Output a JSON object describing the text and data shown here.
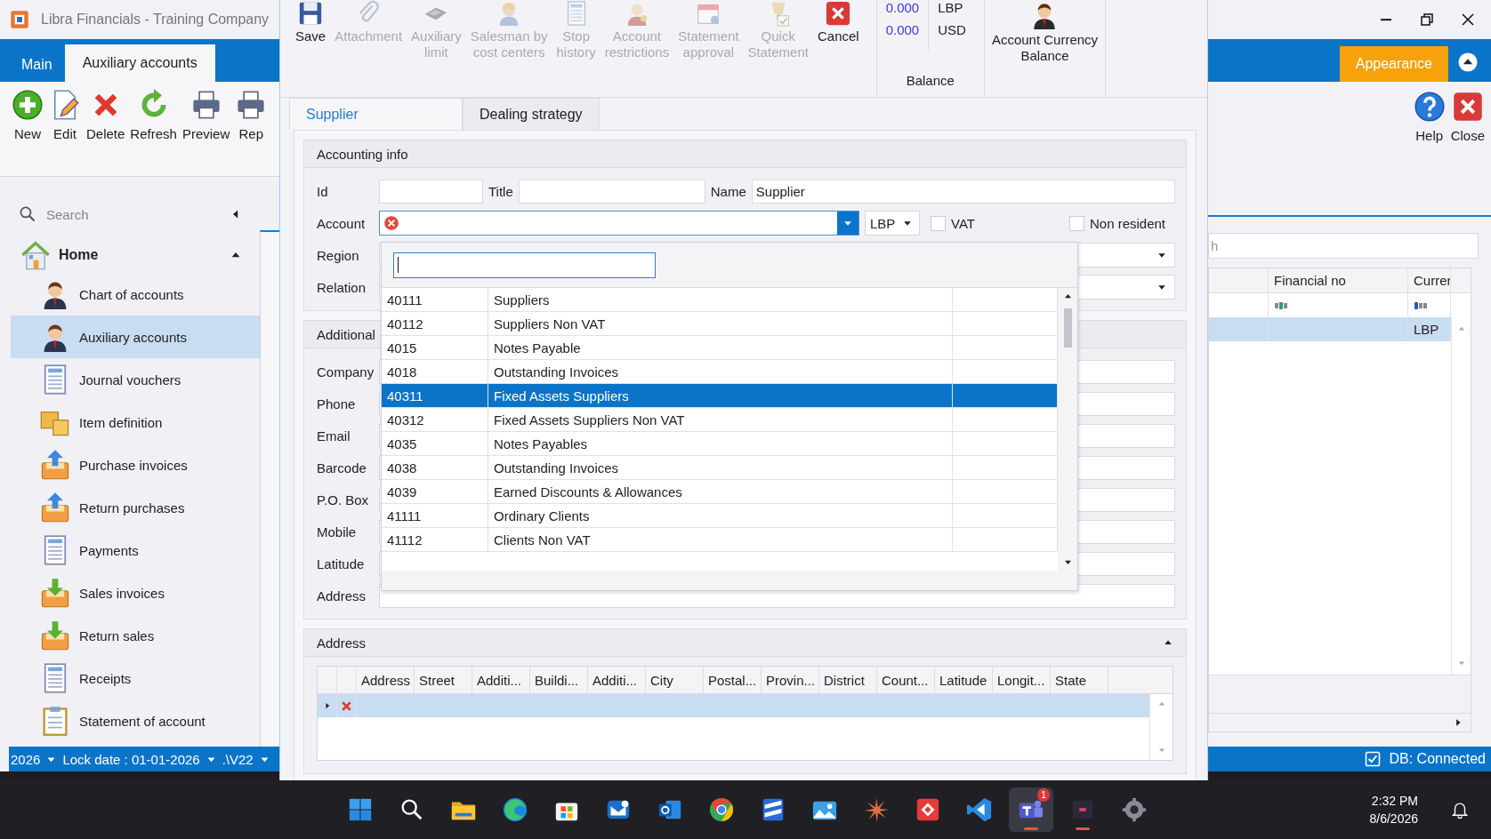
{
  "main_window": {
    "title": "Libra Financials - Training Company",
    "ribbon_tabs": [
      {
        "label": "Main",
        "selected": false
      },
      {
        "label": "Auxiliary accounts",
        "selected": true
      }
    ],
    "ribbon_buttons": [
      {
        "label": "New",
        "kind": "new"
      },
      {
        "label": "Edit",
        "kind": "edit"
      },
      {
        "label": "Delete",
        "kind": "delete"
      },
      {
        "label": "Refresh",
        "kind": "refresh"
      },
      {
        "label": "Preview",
        "kind": "printer"
      },
      {
        "label": "Rep",
        "kind": "printer"
      }
    ],
    "sidebar": {
      "search_placeholder": "Search",
      "group": {
        "label": "Home",
        "expanded": true
      },
      "items": [
        {
          "label": "Chart of accounts",
          "kind": "person",
          "selected": false
        },
        {
          "label": "Auxiliary accounts",
          "kind": "person",
          "selected": true
        },
        {
          "label": "Journal vouchers",
          "kind": "doc",
          "selected": false
        },
        {
          "label": "Item definition",
          "kind": "boxes",
          "selected": false
        },
        {
          "label": "Purchase invoices",
          "kind": "tray-up",
          "selected": false
        },
        {
          "label": "Return purchases",
          "kind": "tray-up",
          "selected": false
        },
        {
          "label": "Payments",
          "kind": "doc",
          "selected": false
        },
        {
          "label": "Sales invoices",
          "kind": "tray-down",
          "selected": false
        },
        {
          "label": "Return sales",
          "kind": "tray-down",
          "selected": false
        },
        {
          "label": "Receipts",
          "kind": "doc",
          "selected": false
        },
        {
          "label": "Statement of account",
          "kind": "clipboard",
          "selected": false
        }
      ]
    },
    "status_bar": {
      "year": "2026",
      "lock_date": "Lock date : 01-01-2026",
      "database": ".\\V22"
    },
    "appearance_button": "Appearance",
    "right_buttons": [
      {
        "label": "Help",
        "kind": "help"
      },
      {
        "label": "Close",
        "kind": "close"
      }
    ],
    "grid": {
      "search_value": "h",
      "columns": [
        {
          "label": "Financial no",
          "kind": "contains"
        },
        {
          "label": "Currer",
          "kind": "begins"
        }
      ],
      "rows": [
        {
          "currency": "LBP",
          "selected": true
        }
      ]
    },
    "db_status": {
      "label": "DB: Connected",
      "checked": true
    }
  },
  "dialog": {
    "toolbar": [
      {
        "lines": [
          "Save"
        ],
        "kind": "save",
        "disabled": false
      },
      {
        "lines": [
          "Attachment"
        ],
        "kind": "clip",
        "disabled": true
      },
      {
        "lines": [
          "Auxiliary",
          "limit"
        ],
        "kind": "card",
        "disabled": true
      },
      {
        "lines": [
          "Salesman by",
          "cost centers"
        ],
        "kind": "worker",
        "disabled": true
      },
      {
        "lines": [
          "Stop",
          "history"
        ],
        "kind": "page",
        "disabled": true
      },
      {
        "lines": [
          "Account",
          "restrictions"
        ],
        "kind": "keyperson",
        "disabled": true
      },
      {
        "lines": [
          "Statement",
          "approval"
        ],
        "kind": "calendar",
        "disabled": true
      },
      {
        "lines": [
          "Quick",
          "Statement"
        ],
        "kind": "quick",
        "disabled": true
      },
      {
        "lines": [
          "Cancel"
        ],
        "kind": "cancel",
        "disabled": false
      }
    ],
    "balance": {
      "rows": [
        {
          "amount": "0.000",
          "currency": "LBP"
        },
        {
          "amount": "0.000",
          "currency": "USD"
        }
      ],
      "label": "Balance"
    },
    "currency_balance_button": [
      "Account Currency",
      "Balance"
    ],
    "tabs": [
      {
        "label": "Supplier",
        "selected": true
      },
      {
        "label": "Dealing strategy",
        "selected": false
      }
    ],
    "accounting_info": {
      "title": "Accounting info",
      "id_label": "Id",
      "title_label": "Title",
      "name_label": "Name",
      "name_value": "Supplier",
      "account_label": "Account",
      "account_error": true,
      "currency": "LBP",
      "vat": {
        "label": "VAT",
        "checked": false
      },
      "non_resident": {
        "label": "Non resident",
        "checked": false
      },
      "region_label": "Region",
      "relation_label": "Relation"
    },
    "additional": {
      "title": "Additional",
      "fields": [
        "Company",
        "Phone",
        "Email",
        "Barcode",
        "P.O. Box",
        "Mobile",
        "Latitude",
        "Address"
      ]
    },
    "address_section": {
      "title": "Address",
      "expanded": true,
      "columns": [
        "Address",
        "Street",
        "Additi...",
        "Buildi...",
        "Additi...",
        "City",
        "Postal...",
        "Provin...",
        "District",
        "Count...",
        "Latitude",
        "Longit...",
        "State"
      ],
      "new_row_selected": true
    },
    "account_dropdown": {
      "rows": [
        {
          "code": "40111",
          "name": "Suppliers",
          "selected": false
        },
        {
          "code": "40112",
          "name": "Suppliers Non VAT",
          "selected": false
        },
        {
          "code": "4015",
          "name": "Notes Payable",
          "selected": false
        },
        {
          "code": "4018",
          "name": "Outstanding Invoices",
          "selected": false
        },
        {
          "code": "40311",
          "name": "Fixed Assets Suppliers",
          "selected": true
        },
        {
          "code": "40312",
          "name": "Fixed Assets Suppliers Non VAT",
          "selected": false
        },
        {
          "code": "4035",
          "name": "Notes Payables",
          "selected": false
        },
        {
          "code": "4038",
          "name": "Outstanding Invoices",
          "selected": false
        },
        {
          "code": "4039",
          "name": "Earned Discounts & Allowances",
          "selected": false
        },
        {
          "code": "41111",
          "name": "Ordinary Clients",
          "selected": false
        },
        {
          "code": "41112",
          "name": "Clients Non VAT",
          "selected": false
        }
      ]
    }
  },
  "taskbar": {
    "apps": [
      {
        "kind": "start",
        "running": false,
        "active": false
      },
      {
        "kind": "tsearch",
        "running": false,
        "active": false
      },
      {
        "kind": "folder",
        "running": false,
        "active": false
      },
      {
        "kind": "edge",
        "running": false,
        "active": false
      },
      {
        "kind": "store",
        "running": false,
        "active": false
      },
      {
        "kind": "mailnew",
        "running": false,
        "active": false
      },
      {
        "kind": "mail",
        "running": false,
        "active": false
      },
      {
        "kind": "chrome",
        "running": false,
        "active": false
      },
      {
        "kind": "stripes",
        "running": false,
        "active": false
      },
      {
        "kind": "photos",
        "running": false,
        "active": false
      },
      {
        "kind": "sunburst",
        "running": false,
        "active": false
      },
      {
        "kind": "diamond",
        "running": false,
        "active": false
      },
      {
        "kind": "vscode",
        "running": false,
        "active": false
      },
      {
        "kind": "teams",
        "running": true,
        "active": true,
        "badge": "1"
      },
      {
        "kind": "terminal",
        "running": true,
        "active": false
      },
      {
        "kind": "settings",
        "running": false,
        "active": false
      }
    ],
    "time": "2:32 PM",
    "date": "8/6/2026"
  }
}
